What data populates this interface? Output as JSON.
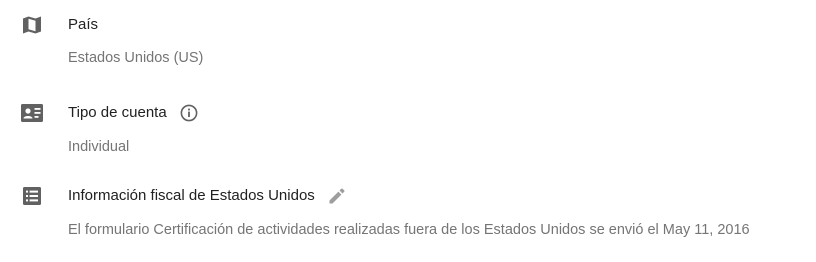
{
  "country": {
    "icon": "map-icon",
    "label": "País",
    "value": "Estados Unidos (US)"
  },
  "account_type": {
    "icon": "contact-card-icon",
    "label": "Tipo de cuenta",
    "info_icon": "info-icon",
    "value": "Individual"
  },
  "tax_info": {
    "icon": "list-icon",
    "label": "Información fiscal de Estados Unidos",
    "edit_icon": "pencil-icon",
    "value": "El formulario Certificación de actividades realizadas fuera de los Estados Unidos se envió el May 11, 2016"
  },
  "colors": {
    "title_text": "#212121",
    "secondary_text": "#757575",
    "icon": "#616161",
    "edit_icon": "#9e9e9e"
  }
}
